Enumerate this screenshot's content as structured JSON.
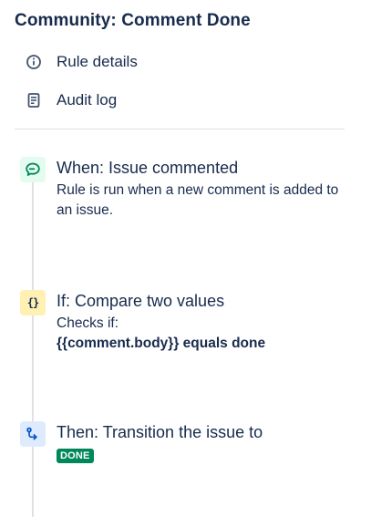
{
  "rule": {
    "title": "Community: Comment Done"
  },
  "nav": {
    "items": [
      {
        "label": "Rule details",
        "icon": "info-icon"
      },
      {
        "label": "Audit log",
        "icon": "document-icon"
      }
    ]
  },
  "components": [
    {
      "type": "trigger",
      "icon": "comment-icon",
      "icon_color": "#00875a",
      "icon_bg": "#e3fcef",
      "title": "When: Issue commented",
      "description": "Rule is run when a new comment is added to an issue."
    },
    {
      "type": "condition",
      "icon": "braces-icon",
      "icon_glyph": "{}",
      "icon_bg": "#fff0b3",
      "title": "If: Compare two values",
      "description": "Checks if:",
      "expression": "{{comment.body}} equals done"
    },
    {
      "type": "action",
      "icon": "transition-icon",
      "icon_color": "#0052cc",
      "icon_bg": "#deebff",
      "title": "Then: Transition the issue to",
      "status": "DONE",
      "status_color": "#00875a"
    }
  ]
}
